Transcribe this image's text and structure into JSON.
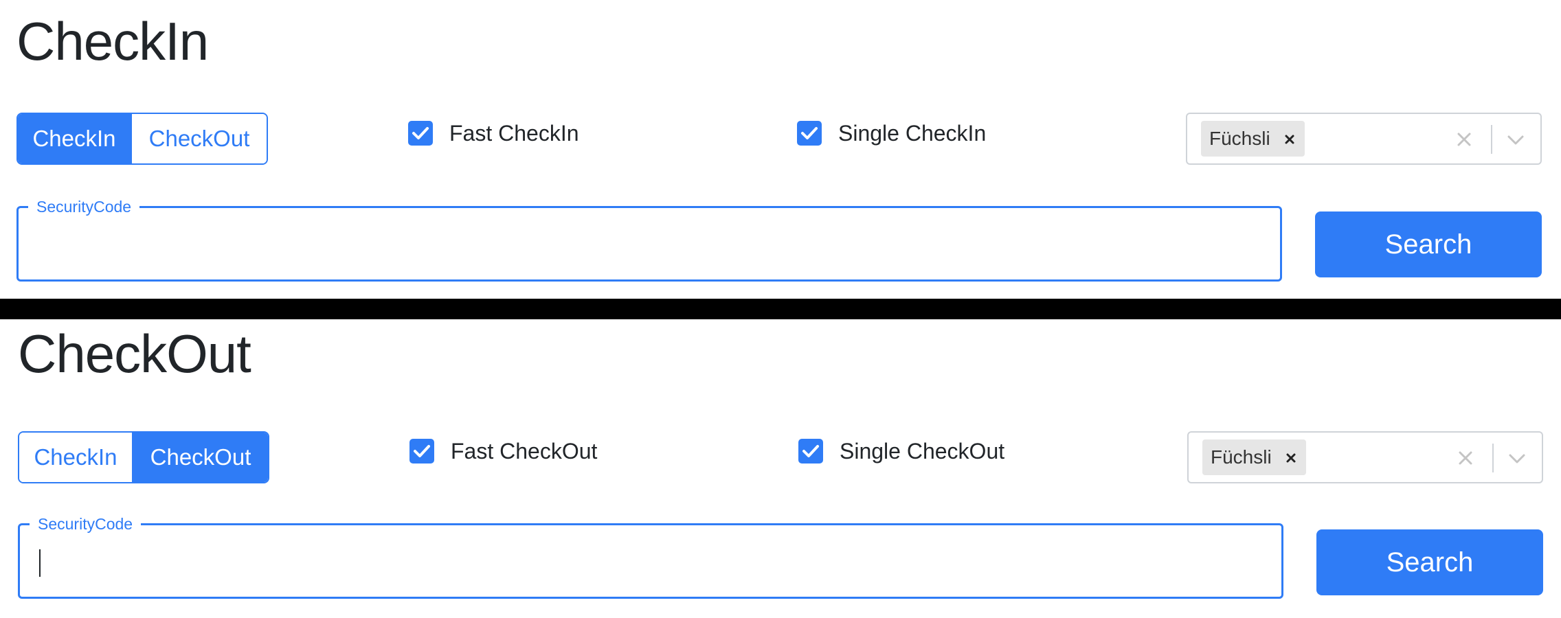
{
  "checkin_panel": {
    "title": "CheckIn",
    "toggle": {
      "option1": "CheckIn",
      "option2": "CheckOut",
      "selected": "CheckIn"
    },
    "fast_checkbox": {
      "label": "Fast CheckIn",
      "checked": true
    },
    "single_checkbox": {
      "label": "Single CheckIn",
      "checked": true
    },
    "select": {
      "chip_label": "Füchsli"
    },
    "security_field": {
      "label": "SecurityCode",
      "value": ""
    },
    "search_label": "Search"
  },
  "checkout_panel": {
    "title": "CheckOut",
    "toggle": {
      "option1": "CheckIn",
      "option2": "CheckOut",
      "selected": "CheckOut"
    },
    "fast_checkbox": {
      "label": "Fast CheckOut",
      "checked": true
    },
    "single_checkbox": {
      "label": "Single CheckOut",
      "checked": true
    },
    "select": {
      "chip_label": "Füchsli"
    },
    "security_field": {
      "label": "SecurityCode",
      "value": ""
    },
    "search_label": "Search"
  },
  "colors": {
    "accent": "#2f7cf6",
    "text": "#212529",
    "chip_bg": "#e6e6e6",
    "select_border": "#cfd3d8",
    "divider": "#000000"
  },
  "icons": {
    "checkbox": "checkmark-icon",
    "chip_remove": "close-icon",
    "select_clear": "clear-icon",
    "select_open": "chevron-down-icon"
  }
}
